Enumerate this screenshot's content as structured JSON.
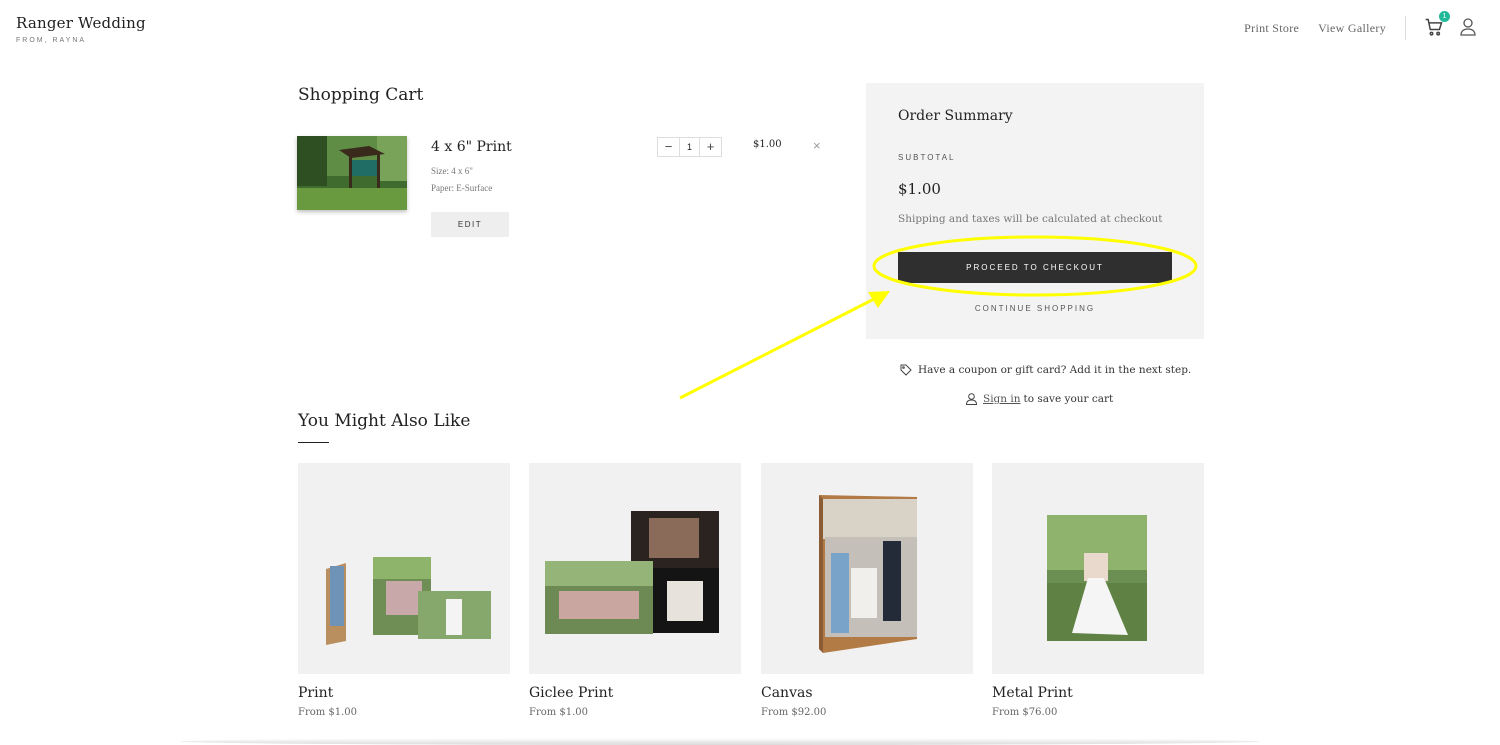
{
  "brand": {
    "title": "Ranger Wedding",
    "subtitle": "FROM, RAYNA"
  },
  "nav": {
    "print_store": "Print Store",
    "view_gallery": "View Gallery",
    "cart_count": "1"
  },
  "cart": {
    "heading": "Shopping Cart",
    "item": {
      "name": "4 x 6\" Print",
      "size": "Size: 4 x 6\"",
      "paper": "Paper: E-Surface",
      "edit_label": "EDIT",
      "quantity": "1",
      "price": "$1.00",
      "minus": "−",
      "plus": "+",
      "remove": "×"
    }
  },
  "summary": {
    "title": "Order Summary",
    "subtotal_label": "SUBTOTAL",
    "subtotal_amount": "$1.00",
    "note": "Shipping and taxes will be calculated at checkout",
    "checkout_label": "PROCEED TO CHECKOUT",
    "continue_label": "CONTINUE SHOPPING"
  },
  "coupon_text": "Have a coupon or gift card? Add it in the next step.",
  "signin": {
    "link": "Sign in",
    "rest": "to save your cart"
  },
  "also": {
    "heading": "You Might Also Like",
    "products": [
      {
        "name": "Print",
        "price": "From $1.00"
      },
      {
        "name": "Giclee Print",
        "price": "From $1.00"
      },
      {
        "name": "Canvas",
        "price": "From $92.00"
      },
      {
        "name": "Metal Print",
        "price": "From $76.00"
      }
    ]
  },
  "colors": {
    "annotation": "#ffff00",
    "checkout_button": "#2f2f2f",
    "cart_badge": "#22b89a",
    "summary_bg": "#f3f3f3"
  }
}
